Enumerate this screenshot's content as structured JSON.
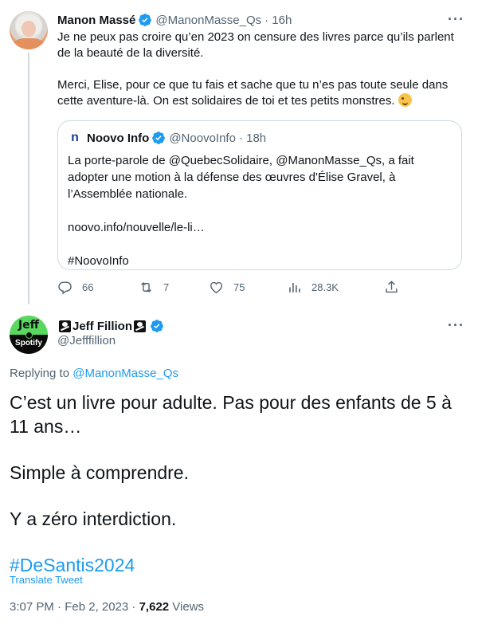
{
  "tweet1": {
    "name": "Manon Massé",
    "handle": "@ManonMasse_Qs",
    "time": "· 16h",
    "paragraph1": "Je ne peux pas croire qu’en 2023 on censure des livres parce qu’ils parlent de la beauté de la diversité.",
    "paragraph2": "Merci, Elise, pour ce que tu fais et sache que tu n’es pas toute seule dans cette aventure-là. On est solidaires de toi et tes petits monstres.",
    "emoji": "winking-face-icon",
    "quote": {
      "name": "Noovo Info",
      "handle": "@NoovoInfo",
      "time": "· 18h",
      "paragraph1": "La porte-parole de @QuebecSolidaire, @ManonMasse_Qs, a fait adopter une motion à la défense des œuvres d'Élise Gravel, à l’Assemblée nationale.",
      "link": "noovo.info/nouvelle/le-li…",
      "hashtag": "#NoovoInfo"
    },
    "actions": {
      "replies": "66",
      "retweets": "7",
      "likes": "75",
      "views": "28.3K"
    }
  },
  "tweet2": {
    "name_prefix_icon": "skull-crossbones-flag-icon",
    "name": "Jeff Fillion",
    "handle": "@Jefffillion",
    "avatar_text_top": "Jeff",
    "avatar_text_bottom": "Spotify",
    "replying_prefix": "Replying to ",
    "replying_to": "@ManonMasse_Qs",
    "line1": "C’est un livre pour adulte. Pas pour des enfants de 5 à 11 ans…",
    "line2": "Simple à comprendre.",
    "line3": "Y a zéro interdiction.",
    "hashtag": "#DeSantis2024",
    "translate": "Translate Tweet",
    "timestamp": "3:07 PM · Feb 2, 2023 · ",
    "views_count": "7,622",
    "views_label": " Views"
  },
  "colors": {
    "accent": "#1d9bf0",
    "text": "#0f1419",
    "muted": "#536471",
    "border": "#cfd9de"
  }
}
